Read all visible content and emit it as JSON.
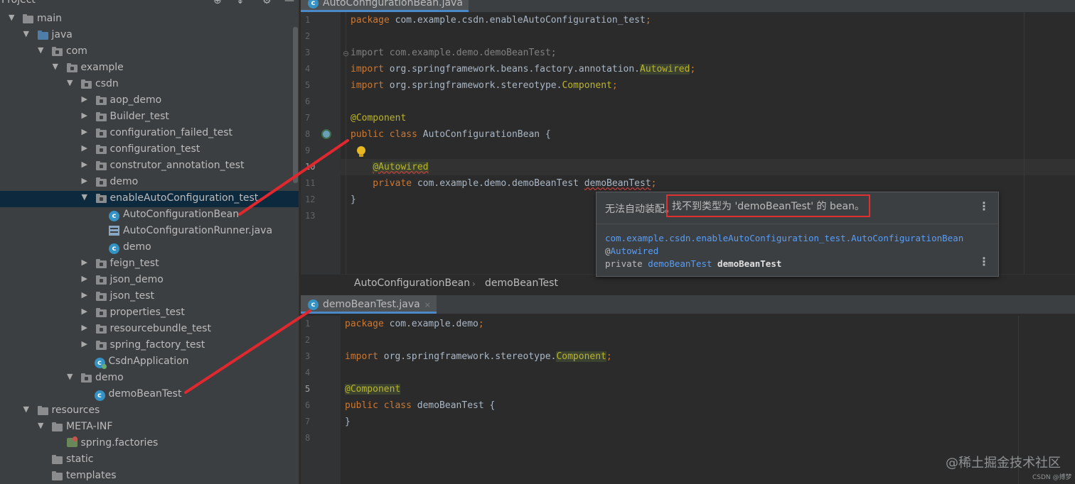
{
  "project_panel": {
    "title": "Project",
    "header_icons": [
      "target-icon",
      "collapse-icon",
      "gear-icon",
      "minimize-icon"
    ],
    "tree": [
      {
        "label": "main",
        "depth": 0,
        "arrow": "open",
        "icon": "folder"
      },
      {
        "label": "java",
        "depth": 1,
        "arrow": "open",
        "icon": "folder-blue"
      },
      {
        "label": "com",
        "depth": 2,
        "arrow": "open",
        "icon": "package"
      },
      {
        "label": "example",
        "depth": 3,
        "arrow": "open",
        "icon": "package"
      },
      {
        "label": "csdn",
        "depth": 4,
        "arrow": "open",
        "icon": "package"
      },
      {
        "label": "aop_demo",
        "depth": 5,
        "arrow": "closed",
        "icon": "package"
      },
      {
        "label": "Builder_test",
        "depth": 5,
        "arrow": "closed",
        "icon": "package"
      },
      {
        "label": "configuration_failed_test",
        "depth": 5,
        "arrow": "closed",
        "icon": "package"
      },
      {
        "label": "configuration_test",
        "depth": 5,
        "arrow": "closed",
        "icon": "package"
      },
      {
        "label": "construtor_annotation_test",
        "depth": 5,
        "arrow": "closed",
        "icon": "package"
      },
      {
        "label": "demo",
        "depth": 5,
        "arrow": "closed",
        "icon": "package"
      },
      {
        "label": "enableAutoConfiguration_test",
        "depth": 5,
        "arrow": "open",
        "icon": "package",
        "selected": true
      },
      {
        "label": "AutoConfigurationBean",
        "depth": 6,
        "arrow": "none",
        "icon": "class"
      },
      {
        "label": "AutoConfigurationRunner.java",
        "depth": 6,
        "arrow": "none",
        "icon": "runner"
      },
      {
        "label": "demo",
        "depth": 6,
        "arrow": "none",
        "icon": "class"
      },
      {
        "label": "feign_test",
        "depth": 5,
        "arrow": "closed",
        "icon": "package"
      },
      {
        "label": "json_demo",
        "depth": 5,
        "arrow": "closed",
        "icon": "package"
      },
      {
        "label": "json_test",
        "depth": 5,
        "arrow": "closed",
        "icon": "package"
      },
      {
        "label": "properties_test",
        "depth": 5,
        "arrow": "closed",
        "icon": "package"
      },
      {
        "label": "resourcebundle_test",
        "depth": 5,
        "arrow": "closed",
        "icon": "package"
      },
      {
        "label": "spring_factory_test",
        "depth": 5,
        "arrow": "closed",
        "icon": "package"
      },
      {
        "label": "CsdnApplication",
        "depth": 5,
        "arrow": "none",
        "icon": "spring-class"
      },
      {
        "label": "demo",
        "depth": 4,
        "arrow": "open",
        "icon": "package"
      },
      {
        "label": "demoBeanTest",
        "depth": 5,
        "arrow": "none",
        "icon": "class"
      },
      {
        "label": "resources",
        "depth": 1,
        "arrow": "open",
        "icon": "folder"
      },
      {
        "label": "META-INF",
        "depth": 2,
        "arrow": "open",
        "icon": "folder"
      },
      {
        "label": "spring.factories",
        "depth": 3,
        "arrow": "none",
        "icon": "factories"
      },
      {
        "label": "static",
        "depth": 2,
        "arrow": "none",
        "icon": "folder"
      },
      {
        "label": "templates",
        "depth": 2,
        "arrow": "none",
        "icon": "folder"
      }
    ]
  },
  "editor_top": {
    "tab_label": "AutoConfigurationBean.java",
    "tab_icon": "class-icon",
    "line_numbers": [
      "1",
      "2",
      "3",
      "4",
      "5",
      "6",
      "7",
      "8",
      "9",
      "10",
      "11",
      "12",
      "13"
    ],
    "current_line": "10",
    "lines": [
      [
        {
          "t": "package ",
          "c": "kw"
        },
        {
          "t": "com.example.csdn.enableAutoConfiguration_test",
          "c": "pl"
        },
        {
          "t": ";",
          "c": "kw"
        }
      ],
      [],
      [
        {
          "t": "import ",
          "c": "imp-gray"
        },
        {
          "t": "com.example.demo.demoBeanTest;",
          "c": "imp-gray"
        }
      ],
      [
        {
          "t": "import ",
          "c": "kw"
        },
        {
          "t": "org.springframework.beans.factory.annotation.",
          "c": "pl"
        },
        {
          "t": "Autowired",
          "c": "an warn-bg"
        },
        {
          "t": ";",
          "c": "kw"
        }
      ],
      [
        {
          "t": "import ",
          "c": "kw"
        },
        {
          "t": "org.springframework.stereotype.",
          "c": "pl"
        },
        {
          "t": "Component",
          "c": "an"
        },
        {
          "t": ";",
          "c": "kw"
        }
      ],
      [],
      [
        {
          "t": "@Component",
          "c": "an"
        }
      ],
      [
        {
          "t": "public class ",
          "c": "kw"
        },
        {
          "t": "AutoConfigurationBean {",
          "c": "pl"
        }
      ],
      [],
      [
        {
          "t": "    ",
          "c": "pl"
        },
        {
          "t": "@Autowired",
          "c": "an warn-bg err-underline"
        }
      ],
      [
        {
          "t": "    private ",
          "c": "kw"
        },
        {
          "t": "com.example.demo.demoBeanTest ",
          "c": "pl"
        },
        {
          "t": "demoBeanTest",
          "c": "pl err-underline"
        },
        {
          "t": ";",
          "c": "kw"
        }
      ],
      [
        {
          "t": "}",
          "c": "pl"
        }
      ],
      []
    ]
  },
  "breadcrumb": {
    "class_name": "AutoConfigurationBean",
    "separator": "›",
    "field_name": "demoBeanTest"
  },
  "popup": {
    "message_prefix": "无法自动装配。",
    "message_highlight": "找不到类型为 'demoBeanTest' 的 bean。",
    "more_glyph": "⋮",
    "code_line1": "com.example.csdn.enableAutoConfiguration_test.AutoConfigurationBean",
    "code_line2_at": "@",
    "code_line2_ann": "Autowired",
    "code_line3_kw": "private ",
    "code_line3_type": "demoBeanTest",
    "code_line3_name": " demoBeanTest"
  },
  "editor_bottom": {
    "tab_label": "demoBeanTest.java",
    "tab_close": "×",
    "tab_icon": "class-icon",
    "line_numbers": [
      "1",
      "2",
      "3",
      "4",
      "5",
      "6",
      "7",
      "8"
    ],
    "current_line": "5",
    "lines": [
      [
        {
          "t": "package ",
          "c": "kw"
        },
        {
          "t": "com.example.demo",
          "c": "pl"
        },
        {
          "t": ";",
          "c": "kw"
        }
      ],
      [],
      [
        {
          "t": "import ",
          "c": "kw"
        },
        {
          "t": "org.springframework.stereotype.",
          "c": "pl"
        },
        {
          "t": "Component",
          "c": "an warn-bg"
        },
        {
          "t": ";",
          "c": "kw"
        }
      ],
      [],
      [
        {
          "t": "@Component",
          "c": "an warn-bg"
        }
      ],
      [
        {
          "t": "public class ",
          "c": "kw"
        },
        {
          "t": "demoBeanTest {",
          "c": "pl"
        }
      ],
      [
        {
          "t": "}",
          "c": "pl"
        }
      ],
      []
    ]
  },
  "colors": {
    "annotation_arrow": "#e0282e",
    "tab_underline": "#4a88c7",
    "keyword": "#cc7832",
    "annotation": "#bbb529"
  },
  "watermark": {
    "main": "@稀土掘金技术社区",
    "small": "CSDN @搏梦"
  }
}
